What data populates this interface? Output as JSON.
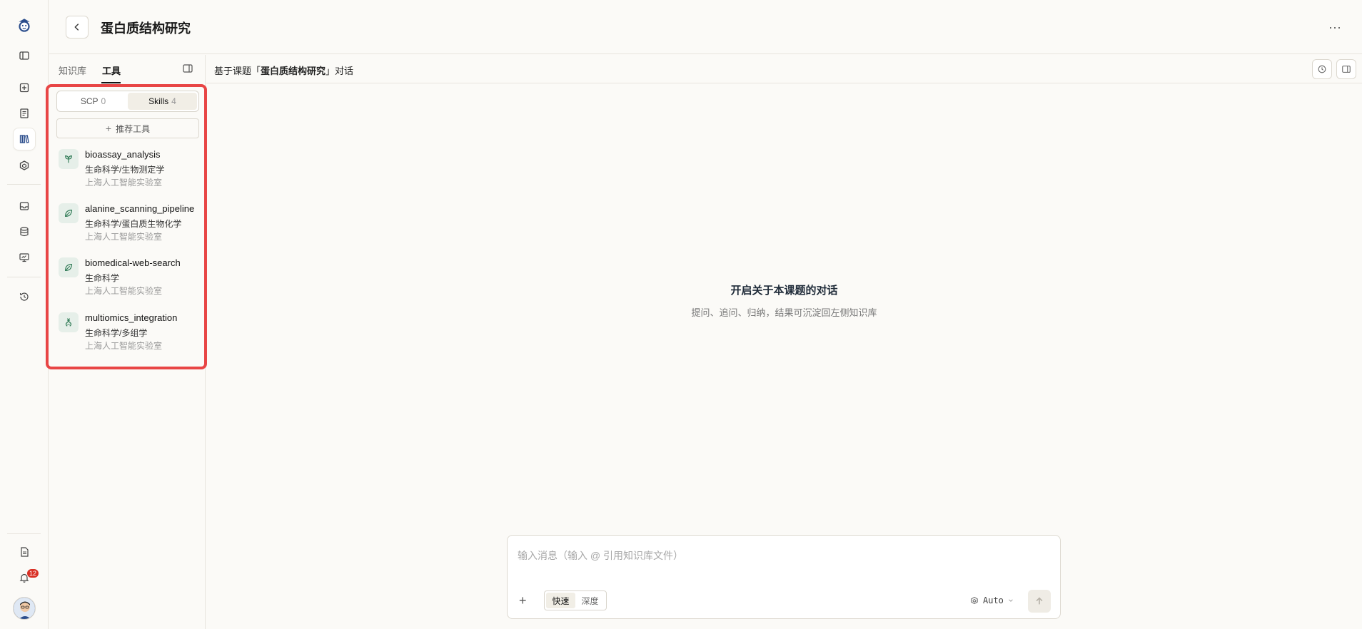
{
  "rail": {
    "items": [
      {
        "name": "logo",
        "icon": "mascot-logo-icon"
      },
      {
        "name": "toggle-sidebar",
        "icon": "sidebar-icon"
      },
      {
        "name": "new",
        "icon": "plus-square-icon"
      },
      {
        "name": "notes",
        "icon": "document-icon"
      },
      {
        "name": "library",
        "icon": "books-icon",
        "active": true
      },
      {
        "name": "models",
        "icon": "cube-icon"
      },
      {
        "name": "inbox",
        "icon": "inbox-icon"
      },
      {
        "name": "database",
        "icon": "database-icon"
      },
      {
        "name": "monitor",
        "icon": "monitor-icon"
      },
      {
        "name": "history",
        "icon": "history-icon"
      },
      {
        "name": "file",
        "icon": "file-icon"
      },
      {
        "name": "notifications",
        "icon": "bell-icon"
      }
    ],
    "notification_count": "12"
  },
  "header": {
    "title": "蛋白质结构研究",
    "more": "···"
  },
  "panel": {
    "tabs": [
      "知识库",
      "工具"
    ],
    "active_tab": "工具",
    "segments": [
      {
        "label": "SCP",
        "count": "0"
      },
      {
        "label": "Skills",
        "count": "4"
      }
    ],
    "recommend_label": "推荐工具",
    "tools": [
      {
        "name": "bioassay_analysis",
        "category": "生命科学/生物测定学",
        "org": "上海人工智能实验室",
        "icon": "sprout-icon"
      },
      {
        "name": "alanine_scanning_pipeline",
        "category": "生命科学/蛋白质生物化学",
        "org": "上海人工智能实验室",
        "icon": "leaf-icon"
      },
      {
        "name": "biomedical-web-search",
        "category": "生命科学",
        "org": "上海人工智能实验室",
        "icon": "leaf-icon"
      },
      {
        "name": "multiomics_integration",
        "category": "生命科学/多组学",
        "org": "上海人工智能实验室",
        "icon": "dna-icon"
      }
    ]
  },
  "chat": {
    "title_prefix": "基于课题「",
    "title_topic": "蛋白质结构研究",
    "title_suffix": "」对话",
    "empty_title": "开启关于本课题的对话",
    "empty_subtitle": "提问、追问、归纳，结果可沉淀回左侧知识库",
    "input_placeholder": "输入消息（输入 @ 引用知识库文件）",
    "modes": [
      "快速",
      "深度"
    ],
    "active_mode": "快速",
    "model_label": "Auto"
  },
  "colors": {
    "accent_blue": "#2b4d8c",
    "highlight": "#e84545",
    "tool_icon_bg": "#e6efe9",
    "tool_icon_fg": "#2f7a55"
  }
}
